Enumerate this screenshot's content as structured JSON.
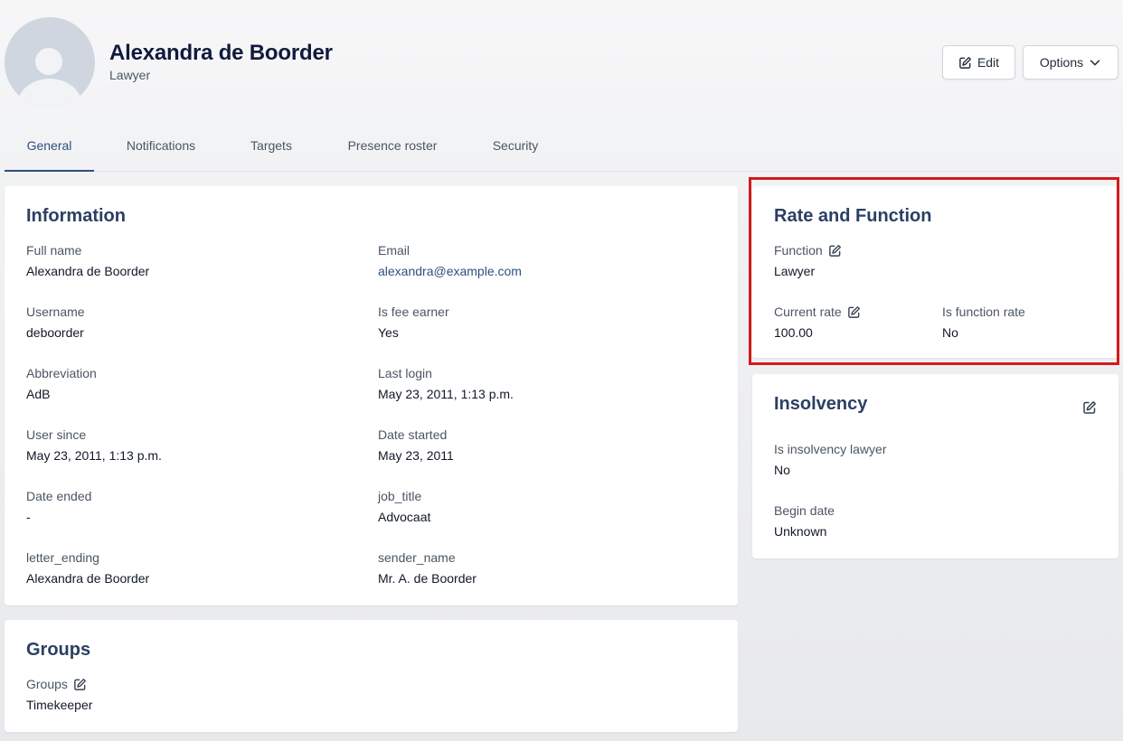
{
  "profile": {
    "name": "Alexandra de Boorder",
    "role": "Lawyer"
  },
  "actions": {
    "edit_label": "Edit",
    "options_label": "Options"
  },
  "tabs": [
    {
      "label": "General",
      "active": true
    },
    {
      "label": "Notifications",
      "active": false
    },
    {
      "label": "Targets",
      "active": false
    },
    {
      "label": "Presence roster",
      "active": false
    },
    {
      "label": "Security",
      "active": false
    }
  ],
  "information": {
    "title": "Information",
    "fields": [
      {
        "label": "Full name",
        "value": "Alexandra de Boorder"
      },
      {
        "label": "Email",
        "value": "alexandra@example.com"
      },
      {
        "label": "Username",
        "value": "deboorder"
      },
      {
        "label": "Is fee earner",
        "value": "Yes"
      },
      {
        "label": "Abbreviation",
        "value": "AdB"
      },
      {
        "label": "Last login",
        "value": "May 23, 2011, 1:13 p.m."
      },
      {
        "label": "User since",
        "value": "May 23, 2011, 1:13 p.m."
      },
      {
        "label": "Date started",
        "value": "May 23, 2011"
      },
      {
        "label": "Date ended",
        "value": "-"
      },
      {
        "label": "job_title",
        "value": "Advocaat"
      },
      {
        "label": "letter_ending",
        "value": "Alexandra de Boorder"
      },
      {
        "label": "sender_name",
        "value": "Mr. A. de Boorder"
      }
    ]
  },
  "groups": {
    "title": "Groups",
    "label": "Groups",
    "value": "Timekeeper"
  },
  "rate_function": {
    "title": "Rate and Function",
    "function_label": "Function",
    "function_value": "Lawyer",
    "current_rate_label": "Current rate",
    "current_rate_value": "100.00",
    "is_function_rate_label": "Is function rate",
    "is_function_rate_value": "No"
  },
  "insolvency": {
    "title": "Insolvency",
    "is_lawyer_label": "Is insolvency lawyer",
    "is_lawyer_value": "No",
    "begin_date_label": "Begin date",
    "begin_date_value": "Unknown"
  },
  "colors": {
    "accent": "#2f4f7f",
    "highlight": "#d41a1a"
  },
  "icons": {
    "edit": "edit-icon",
    "chevron": "chevron-down-icon",
    "avatar": "avatar-placeholder"
  }
}
